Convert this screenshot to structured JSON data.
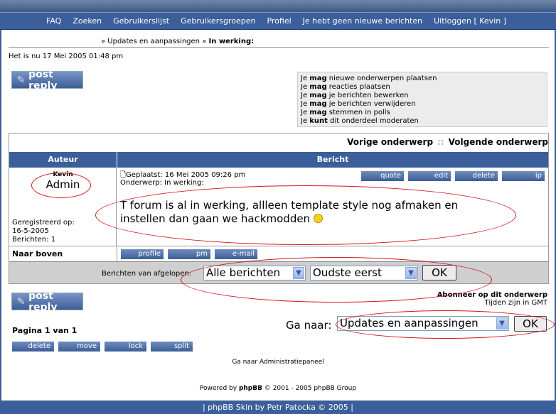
{
  "nav": {
    "items": [
      "FAQ",
      "Zoeken",
      "Gebruikerslijst",
      "Gebruikersgroepen",
      "Profiel",
      "Je hebt geen nieuwe berichten",
      "Uitloggen [ Kevin ]"
    ]
  },
  "breadcrumb": {
    "forum": "» Updates en aanpassingen",
    "sep": " » ",
    "topic": "In werking:"
  },
  "datetime": "Het is nu 17 Mei 2005 01:48 pm",
  "post_reply_label": "post reply",
  "permissions": [
    {
      "pre": "Je ",
      "bold": "mag",
      "post": " nieuwe onderwerpen plaatsen"
    },
    {
      "pre": "Je ",
      "bold": "mag",
      "post": " reacties plaatsen"
    },
    {
      "pre": "Je ",
      "bold": "mag",
      "post": " je berichten bewerken"
    },
    {
      "pre": "Je ",
      "bold": "mag",
      "post": " je berichten verwijderen"
    },
    {
      "pre": "Je ",
      "bold": "mag",
      "post": " stemmen in polls"
    },
    {
      "pre": "Je ",
      "bold": "kunt",
      "post": " dit onderdeel moderaten"
    }
  ],
  "topicnav": {
    "prev": "Vorige onderwerp",
    "sep": "::",
    "next": "Volgende onderwerp"
  },
  "table": {
    "col_author": "Auteur",
    "col_post": "Bericht"
  },
  "post": {
    "author": "Kevin",
    "rank": "Admin",
    "reg_label": "Geregistreerd op:",
    "reg_date": "16-5-2005",
    "posts": "Berichten: 1",
    "posted": "Geplaatst: 16 Mei 2005 09:26 pm",
    "subject": "Onderwerp: In werking:",
    "body_line1": "T forum is al in werking, allleen template style nog afmaken en",
    "body_line2": "instellen dan gaan we hackmodden",
    "buttons": {
      "quote": "quote",
      "edit": "edit",
      "delete": "delete",
      "ip": "ip",
      "profile": "profile",
      "pm": "pm",
      "email": "e-mail"
    }
  },
  "back_to_top": "Naar boven",
  "filter": {
    "label": "Berichten van afgelopen:",
    "period": "Alle berichten",
    "order": "Oudste eerst",
    "ok": "OK"
  },
  "subscribe": {
    "link": "Abonneer op dit onderwerp",
    "tz": "Tijden zijn in GMT"
  },
  "pagination": "Pagina 1 van 1",
  "jump": {
    "label": "Ga naar:",
    "value": "Updates en aanpassingen",
    "ok": "OK"
  },
  "mod": {
    "delete": "delete",
    "move": "move",
    "lock": "lock",
    "split": "split"
  },
  "admin_link": "Ga naar Administratiepaneel",
  "powered": {
    "pre": "Powered by ",
    "bold": "phpBB",
    "post": " © 2001 - 2005 phpBB Group"
  },
  "footer": "| phpBB Skin by Petr Patocka © 2005 |",
  "colors": {
    "bar": "#3a5f9a",
    "annotation": "#d4141e",
    "filter_bg": "#cfcfcf"
  }
}
